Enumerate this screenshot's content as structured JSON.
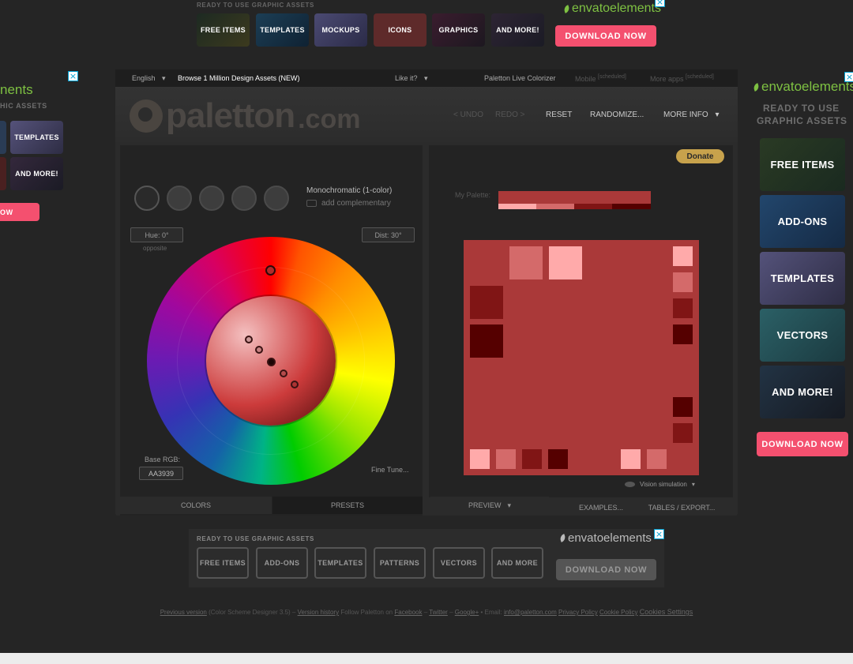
{
  "top_ad": {
    "caption": "READY TO USE GRAPHIC ASSETS",
    "tiles": [
      "FREE ITEMS",
      "TEMPLATES",
      "MOCKUPS",
      "ICONS",
      "GRAPHICS",
      "AND MORE!"
    ],
    "brand": "envatoelements",
    "download": "DOWNLOAD NOW"
  },
  "left_ad": {
    "brand": "nents",
    "caption": "HIC ASSETS",
    "tiles": [
      "TEMPLATES",
      "AND MORE!"
    ],
    "download": "OW"
  },
  "right_ad": {
    "brand": "envatoelements",
    "caption_line1": "READY TO USE",
    "caption_line2": "GRAPHIC ASSETS",
    "tiles": [
      "FREE ITEMS",
      "ADD-ONS",
      "TEMPLATES",
      "VECTORS",
      "AND MORE!"
    ],
    "download": "DOWNLOAD NOW"
  },
  "topbar": {
    "language": "English",
    "browse": "Browse 1 Million Design Assets (NEW)",
    "like": "Like it?",
    "colorizer": "Paletton Live Colorizer",
    "mobile": "Mobile",
    "mobile_note": "[scheduled]",
    "more_apps": "More apps",
    "more_apps_note": "[scheduled]"
  },
  "header": {
    "logo_word": "paletton",
    "logo_domain": ".com",
    "undo": "< UNDO",
    "redo": "REDO >",
    "reset": "RESET",
    "randomize": "RANDOMIZE...",
    "more_info": "MORE INFO"
  },
  "left_panel": {
    "scheme_name": "Monochromatic (1-color)",
    "add_complementary": "add complementary",
    "hue": "Hue: 0°",
    "opposite": "opposite",
    "dist": "Dist: 30°",
    "base_rgb_label": "Base RGB:",
    "base_rgb_value": "AA3939",
    "fine_tune": "Fine Tune...",
    "tab_colors": "COLORS",
    "tab_presets": "PRESETS"
  },
  "right_panel": {
    "donate": "Donate",
    "my_palette": "My Palette:",
    "vision": "Vision simulation",
    "tab_preview": "PREVIEW",
    "tab_examples": "EXAMPLES...",
    "tab_tables": "TABLES / EXPORT..."
  },
  "palette": {
    "base": "#AA3939",
    "shades": [
      "#FFAAAA",
      "#D46A6A",
      "#801515",
      "#550000"
    ]
  },
  "bottom_ad": {
    "caption": "READY TO USE GRAPHIC ASSETS",
    "brand": "envatoelements",
    "tiles": [
      "FREE ITEMS",
      "ADD-ONS",
      "TEMPLATES",
      "PATTERNS",
      "VECTORS",
      "AND MORE"
    ],
    "download": "DOWNLOAD NOW"
  },
  "footer": {
    "prev_version": "Previous version",
    "prev_note": "(Color Scheme Designer 3.5)",
    "sep1": "–",
    "version_history": "Version history",
    "follow": "Follow Paletton on",
    "facebook": "Facebook",
    "sep2": "–",
    "twitter": "Twitter",
    "sep3": "–",
    "google": "Google+",
    "email_label": "•   Email:",
    "email": "info@paletton.com",
    "privacy": "Privacy Policy",
    "cookie": "Cookie Policy",
    "cookie_settings": "Cookies Settings"
  }
}
